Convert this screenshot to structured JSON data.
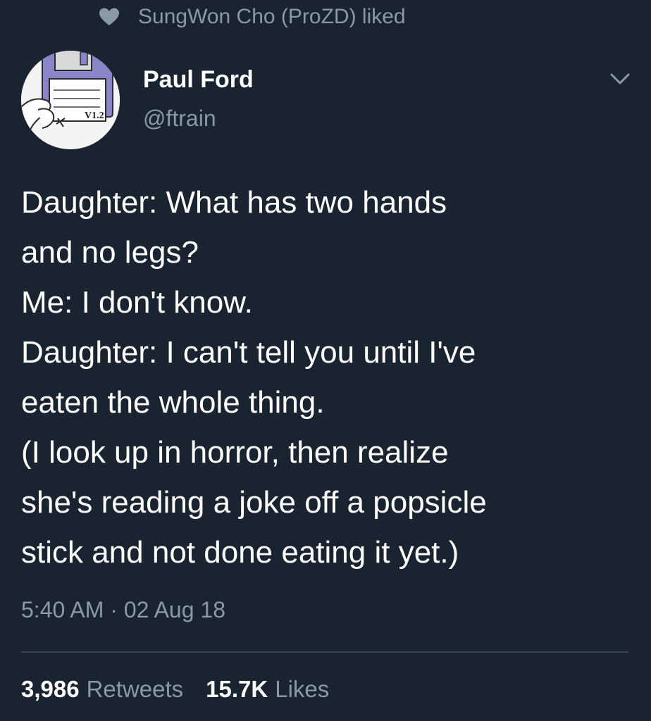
{
  "social_context": {
    "icon": "heart-icon",
    "text": "SungWon Cho (ProZD) liked"
  },
  "author": {
    "name": "Paul Ford",
    "handle": "@ftrain",
    "avatar": {
      "icon": "floppy-disk-avatar",
      "label_text": "V1.2"
    }
  },
  "menu_icon": "chevron-down-icon",
  "tweet": {
    "lines": [
      "Daughter: What has two hands",
      "and no legs?",
      "Me: I don't know.",
      "Daughter: I can't tell you until I've",
      "eaten the whole thing.",
      "(I look up in horror, then realize",
      "she's reading a joke off a popsicle",
      "stick and not done eating it yet.)"
    ]
  },
  "meta": {
    "timestamp": "5:40 AM · 02 Aug 18"
  },
  "stats": {
    "retweets_count": "3,986",
    "retweets_label": "Retweets",
    "likes_count": "15.7K",
    "likes_label": "Likes"
  },
  "colors": {
    "background": "#1a2330",
    "primary_text": "#ffffff",
    "secondary_text": "#8b98a5",
    "divider": "#37434f"
  }
}
